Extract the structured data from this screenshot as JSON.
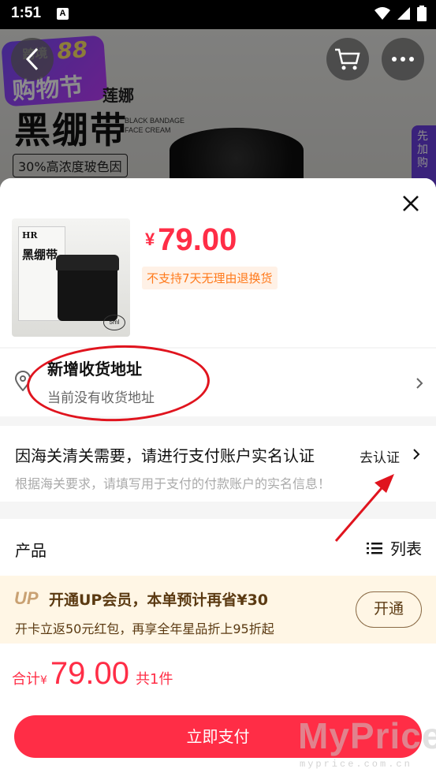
{
  "status_bar": {
    "time": "1:51",
    "notification": "A"
  },
  "background_page": {
    "festival_small": "跨境",
    "festival_num": "88",
    "festival_big": "购物节",
    "brand": "莲娜",
    "title": "黑绷带",
    "subtitle_line1": "BLACK BANDAGE",
    "subtitle_line2": "FACE CREAM",
    "badge": "30%高浓度玻色因",
    "side_tag": "先加购"
  },
  "product": {
    "box_brand": "HR",
    "box_name": "黑绷带",
    "size": "5ml",
    "price_currency": "¥",
    "price": "79.00",
    "no_return_notice": "不支持7天无理由退换货"
  },
  "address": {
    "title": "新增收货地址",
    "subtitle": "当前没有收货地址"
  },
  "verification": {
    "title": "因海关清关需要，请进行支付账户实名认证",
    "link": "去认证",
    "subtitle": "根据海关要求，请填写用于支付的付款账户的实名信息！"
  },
  "product_section": {
    "label": "产品",
    "list_label": "列表"
  },
  "vip": {
    "logo": "UP",
    "title": "开通UP会员，本单预计再省¥30",
    "subtitle": "开卡立返50元红包，再享全年星品折上95折起",
    "button": "开通"
  },
  "footer": {
    "total_label": "合计",
    "currency": "¥",
    "total": "79.00",
    "count": "共1件",
    "pay_button": "立即支付"
  },
  "watermark": {
    "big": "MyPrice",
    "small": "myprice.com.cn"
  },
  "colors": {
    "accent": "#ff2d46",
    "vip_bg": "#fff6e5",
    "annotation": "#e0141e"
  }
}
